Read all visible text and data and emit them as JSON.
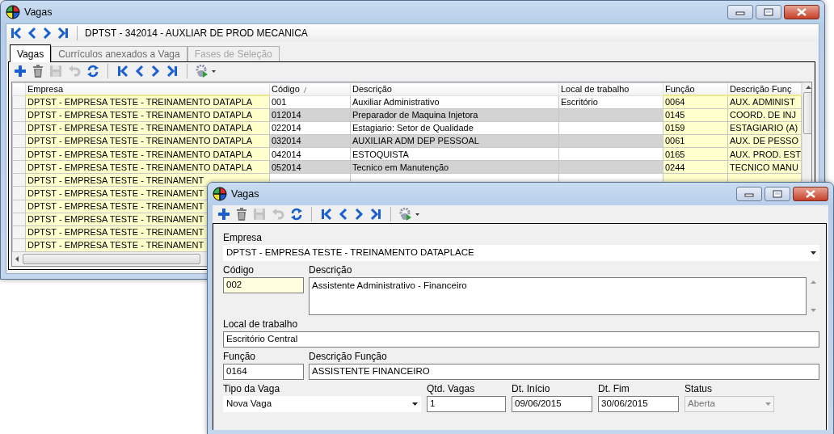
{
  "main_window": {
    "title": "Vagas",
    "nav_buttons": [
      {
        "kind": "first"
      },
      {
        "kind": "prev"
      },
      {
        "kind": "next"
      },
      {
        "kind": "last"
      }
    ],
    "record_label": "DPTST - 342014 - AUXLIAR DE PROD MECANICA",
    "tabs": [
      {
        "label": "Vagas",
        "selected": true,
        "disabled": false
      },
      {
        "label": "Currículos anexados a Vaga",
        "selected": false,
        "disabled": false
      },
      {
        "label": "Fases de Seleção",
        "selected": false,
        "disabled": true
      }
    ],
    "toolbar": [
      {
        "kind": "add",
        "disabled": false
      },
      {
        "kind": "delete",
        "disabled": false
      },
      {
        "kind": "save",
        "disabled": true
      },
      {
        "kind": "undo",
        "disabled": true
      },
      {
        "kind": "refresh",
        "disabled": false
      },
      {
        "kind": "separator"
      },
      {
        "kind": "first",
        "disabled": false
      },
      {
        "kind": "prev",
        "disabled": false
      },
      {
        "kind": "next",
        "disabled": false
      },
      {
        "kind": "last",
        "disabled": false
      },
      {
        "kind": "separator"
      },
      {
        "kind": "actions",
        "disabled": false
      }
    ],
    "grid": {
      "columns": [
        {
          "label": "Empresa",
          "highlight": true,
          "sorted": false
        },
        {
          "label": "Código",
          "highlight": false,
          "sorted": true
        },
        {
          "label": "Descrição",
          "highlight": false,
          "sorted": false
        },
        {
          "label": "Local de trabalho",
          "highlight": false,
          "sorted": false
        },
        {
          "label": "Função",
          "highlight": true,
          "sorted": false
        },
        {
          "label": "Descrição Funç",
          "highlight": true,
          "sorted": false
        }
      ],
      "rows": [
        {
          "cells": [
            "DPTST - EMPRESA TESTE - TREINAMENTO DATAPLA",
            "001",
            "Auxiliar Administrativo",
            "Escritório",
            "0064",
            "AUX. ADMINIST"
          ]
        },
        {
          "cells": [
            "DPTST - EMPRESA TESTE - TREINAMENTO DATAPLA",
            "012014",
            "Preparador de Maquina Injetora",
            "",
            "0145",
            "COORD. DE INJ"
          ]
        },
        {
          "cells": [
            "DPTST - EMPRESA TESTE - TREINAMENTO DATAPLA",
            "022014",
            "Estagiario: Setor de Qualidade",
            "",
            "0159",
            "ESTAGIARIO (A)"
          ]
        },
        {
          "cells": [
            "DPTST - EMPRESA TESTE - TREINAMENTO DATAPLA",
            "032014",
            "AUXILIAR ADM DEP PESSOAL",
            "",
            "0061",
            "AUX. DE PESSO"
          ]
        },
        {
          "cells": [
            "DPTST - EMPRESA TESTE - TREINAMENTO DATAPLA",
            "042014",
            "ESTOQUISTA",
            "",
            "0165",
            "AUX. PROD. EST"
          ]
        },
        {
          "cells": [
            "DPTST - EMPRESA TESTE - TREINAMENTO DATAPLA",
            "052014",
            "Tecnico em Manutenção",
            "",
            "0244",
            "TECNICO MANU"
          ]
        },
        {
          "cells": [
            "DPTST - EMPRESA TESTE - TREINAMENT"
          ]
        },
        {
          "cells": [
            "DPTST - EMPRESA TESTE - TREINAMENT"
          ]
        },
        {
          "cells": [
            "DPTST - EMPRESA TESTE - TREINAMENT"
          ]
        },
        {
          "cells": [
            "DPTST - EMPRESA TESTE - TREINAMENT"
          ]
        },
        {
          "cells": [
            "DPTST - EMPRESA TESTE - TREINAMENT"
          ]
        },
        {
          "cells": [
            "DPTST - EMPRESA TESTE - TREINAMENT"
          ]
        }
      ]
    }
  },
  "dialog": {
    "title": "Vagas",
    "toolbar": [
      {
        "kind": "add",
        "disabled": false
      },
      {
        "kind": "delete",
        "disabled": false
      },
      {
        "kind": "save",
        "disabled": true
      },
      {
        "kind": "undo",
        "disabled": true
      },
      {
        "kind": "refresh",
        "disabled": false
      },
      {
        "kind": "separator"
      },
      {
        "kind": "first",
        "disabled": false
      },
      {
        "kind": "prev",
        "disabled": false
      },
      {
        "kind": "next",
        "disabled": false
      },
      {
        "kind": "last",
        "disabled": false
      },
      {
        "kind": "separator"
      },
      {
        "kind": "actions",
        "disabled": false
      }
    ],
    "form_rows": [
      [
        {
          "label": "Empresa",
          "value": "DPTST - EMPRESA TESTE - TREINAMENTO DATAPLACE",
          "kind": "combo",
          "highlight": false,
          "disabled": false
        }
      ],
      [
        {
          "label": "Código",
          "value": "002",
          "kind": "text",
          "highlight": true,
          "disabled": false
        },
        {
          "label": "Descrição",
          "value": "Assistente Administrativo - Financeiro",
          "kind": "memo",
          "highlight": false,
          "disabled": false
        }
      ],
      [
        {
          "label": "Local de trabalho",
          "value": "Escritório Central",
          "kind": "text",
          "highlight": false,
          "disabled": false
        }
      ],
      [
        {
          "label": "Função",
          "value": "0164",
          "kind": "text",
          "highlight": false,
          "disabled": false
        },
        {
          "label": "Descrição Função",
          "value": "ASSISTENTE FINANCEIRO",
          "kind": "text",
          "highlight": false,
          "disabled": false
        }
      ],
      [
        {
          "label": "Tipo da Vaga",
          "value": "Nova Vaga",
          "kind": "combo",
          "highlight": false,
          "disabled": false
        },
        {
          "label": "Qtd. Vagas",
          "value": "1",
          "kind": "text",
          "highlight": false,
          "disabled": false
        },
        {
          "label": "Dt. Início",
          "value": "09/06/2015",
          "kind": "text",
          "highlight": false,
          "disabled": false
        },
        {
          "label": "Dt. Fim",
          "value": "30/06/2015",
          "kind": "text",
          "highlight": false,
          "disabled": false
        },
        {
          "label": "Status",
          "value": "Aberta",
          "kind": "combo",
          "highlight": false,
          "disabled": true
        }
      ]
    ]
  }
}
